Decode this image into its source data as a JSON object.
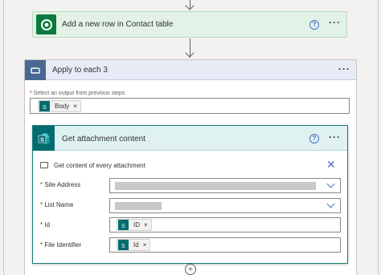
{
  "card_add_row": {
    "title": "Add a new row in Contact table",
    "help": "?",
    "more": "···"
  },
  "apply_each": {
    "title": "Apply to each 3",
    "more": "···",
    "select_label_req": "*",
    "select_label": " Select an output from previous steps",
    "token": "Body"
  },
  "get_attachment": {
    "title": "Get attachment content",
    "help": "?",
    "more": "···",
    "note": "Get content of every attachment",
    "fields": [
      {
        "req": "*",
        "label": " Site Address"
      },
      {
        "req": "*",
        "label": " List Name"
      },
      {
        "req": "*",
        "label": " Id",
        "token": "ID"
      },
      {
        "req": "*",
        "label": " File Identifier",
        "token": "Id"
      }
    ]
  },
  "token_remove": "×",
  "add_step": "+"
}
